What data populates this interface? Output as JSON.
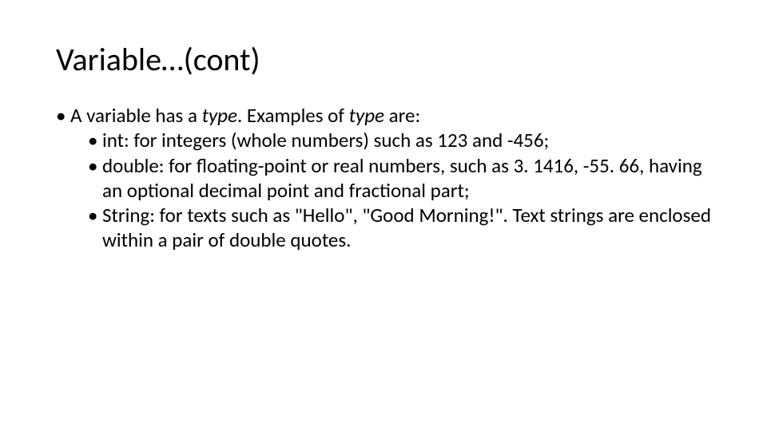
{
  "slide": {
    "title": "Variable…(cont)",
    "intro_pre": "A variable has a ",
    "intro_em1": "type",
    "intro_mid": ". Examples of ",
    "intro_em2": "type",
    "intro_post": " are:",
    "items": {
      "int": "int: for integers (whole numbers) such as 123 and -456;",
      "double": "double: for floating-point or real numbers, such as 3. 1416, -55. 66, having an optional decimal point and fractional part;",
      "string": "String: for texts such as \"Hello\", \"Good Morning!\". Text strings are enclosed within a pair of double quotes."
    }
  }
}
